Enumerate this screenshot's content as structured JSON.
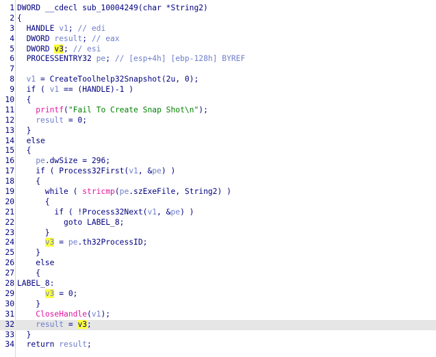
{
  "editor": {
    "highlight_variable": "v3",
    "current_line": 32,
    "lines": [
      {
        "n": "1",
        "tokens": [
          [
            "kw",
            "DWORD"
          ],
          [
            "tx",
            " __cdecl sub_10004249(char *String2)"
          ]
        ]
      },
      {
        "n": "2",
        "tokens": [
          [
            "tx",
            "{"
          ]
        ]
      },
      {
        "n": "3",
        "tokens": [
          [
            "tx",
            "  HANDLE "
          ],
          [
            "var",
            "v1"
          ],
          [
            "tx",
            "; "
          ],
          [
            "cm",
            "// edi"
          ]
        ]
      },
      {
        "n": "4",
        "tokens": [
          [
            "tx",
            "  DWORD "
          ],
          [
            "var",
            "result"
          ],
          [
            "tx",
            "; "
          ],
          [
            "cm",
            "// eax"
          ]
        ]
      },
      {
        "n": "5",
        "tokens": [
          [
            "tx",
            "  DWORD "
          ],
          [
            "hl",
            "v3"
          ],
          [
            "tx",
            "; "
          ],
          [
            "cm",
            "// esi"
          ]
        ]
      },
      {
        "n": "6",
        "tokens": [
          [
            "tx",
            "  PROCESSENTRY32 "
          ],
          [
            "var",
            "pe"
          ],
          [
            "tx",
            "; "
          ],
          [
            "cm",
            "// [esp+4h] [ebp-128h] BYREF"
          ]
        ]
      },
      {
        "n": "7",
        "tokens": []
      },
      {
        "n": "8",
        "tokens": [
          [
            "tx",
            "  "
          ],
          [
            "var",
            "v1"
          ],
          [
            "tx",
            " = CreateToolhelp32Snapshot(2u, 0);"
          ]
        ]
      },
      {
        "n": "9",
        "tokens": [
          [
            "tx",
            "  if ( "
          ],
          [
            "var",
            "v1"
          ],
          [
            "tx",
            " == (HANDLE)-1 )"
          ]
        ]
      },
      {
        "n": "10",
        "tokens": [
          [
            "tx",
            "  {"
          ]
        ]
      },
      {
        "n": "11",
        "tokens": [
          [
            "tx",
            "    "
          ],
          [
            "imp",
            "printf"
          ],
          [
            "tx",
            "("
          ],
          [
            "str",
            "\"Fail To Create Snap Shot\\n\""
          ],
          [
            "tx",
            ");"
          ]
        ]
      },
      {
        "n": "12",
        "tokens": [
          [
            "tx",
            "    "
          ],
          [
            "var",
            "result"
          ],
          [
            "tx",
            " = 0;"
          ]
        ]
      },
      {
        "n": "13",
        "tokens": [
          [
            "tx",
            "  }"
          ]
        ]
      },
      {
        "n": "14",
        "tokens": [
          [
            "tx",
            "  else"
          ]
        ]
      },
      {
        "n": "15",
        "tokens": [
          [
            "tx",
            "  {"
          ]
        ]
      },
      {
        "n": "16",
        "tokens": [
          [
            "tx",
            "    "
          ],
          [
            "var",
            "pe"
          ],
          [
            "tx",
            ".dwSize = 296;"
          ]
        ]
      },
      {
        "n": "17",
        "tokens": [
          [
            "tx",
            "    if ( Process32First("
          ],
          [
            "var",
            "v1"
          ],
          [
            "tx",
            ", &"
          ],
          [
            "var",
            "pe"
          ],
          [
            "tx",
            ") )"
          ]
        ]
      },
      {
        "n": "18",
        "tokens": [
          [
            "tx",
            "    {"
          ]
        ]
      },
      {
        "n": "19",
        "tokens": [
          [
            "tx",
            "      while ( "
          ],
          [
            "imp",
            "stricmp"
          ],
          [
            "tx",
            "("
          ],
          [
            "var",
            "pe"
          ],
          [
            "tx",
            ".szExeFile, String2) )"
          ]
        ]
      },
      {
        "n": "20",
        "tokens": [
          [
            "tx",
            "      {"
          ]
        ]
      },
      {
        "n": "21",
        "tokens": [
          [
            "tx",
            "        if ( !Process32Next("
          ],
          [
            "var",
            "v1"
          ],
          [
            "tx",
            ", &"
          ],
          [
            "var",
            "pe"
          ],
          [
            "tx",
            ") )"
          ]
        ]
      },
      {
        "n": "22",
        "tokens": [
          [
            "tx",
            "          goto LABEL_8;"
          ]
        ]
      },
      {
        "n": "23",
        "tokens": [
          [
            "tx",
            "      }"
          ]
        ]
      },
      {
        "n": "24",
        "tokens": [
          [
            "tx",
            "      "
          ],
          [
            "hlv",
            "v3"
          ],
          [
            "tx",
            " = "
          ],
          [
            "var",
            "pe"
          ],
          [
            "tx",
            ".th32ProcessID;"
          ]
        ]
      },
      {
        "n": "25",
        "tokens": [
          [
            "tx",
            "    }"
          ]
        ]
      },
      {
        "n": "26",
        "tokens": [
          [
            "tx",
            "    else"
          ]
        ]
      },
      {
        "n": "27",
        "tokens": [
          [
            "tx",
            "    {"
          ]
        ]
      },
      {
        "n": "28",
        "tokens": [
          [
            "tx",
            "LABEL_8:"
          ]
        ]
      },
      {
        "n": "29",
        "tokens": [
          [
            "tx",
            "      "
          ],
          [
            "hlv",
            "v3"
          ],
          [
            "tx",
            " = 0;"
          ]
        ]
      },
      {
        "n": "30",
        "tokens": [
          [
            "tx",
            "    }"
          ]
        ]
      },
      {
        "n": "31",
        "tokens": [
          [
            "tx",
            "    "
          ],
          [
            "imp",
            "CloseHandle"
          ],
          [
            "tx",
            "("
          ],
          [
            "var",
            "v1"
          ],
          [
            "tx",
            ");"
          ]
        ]
      },
      {
        "n": "32",
        "tokens": [
          [
            "tx",
            "    "
          ],
          [
            "var",
            "result"
          ],
          [
            "tx",
            " = "
          ],
          [
            "hl",
            "v3"
          ],
          [
            "tx",
            ";"
          ]
        ]
      },
      {
        "n": "33",
        "tokens": [
          [
            "tx",
            "  }"
          ]
        ]
      },
      {
        "n": "34",
        "tokens": [
          [
            "tx",
            "  return "
          ],
          [
            "var",
            "result"
          ],
          [
            "tx",
            ";"
          ]
        ]
      }
    ]
  }
}
